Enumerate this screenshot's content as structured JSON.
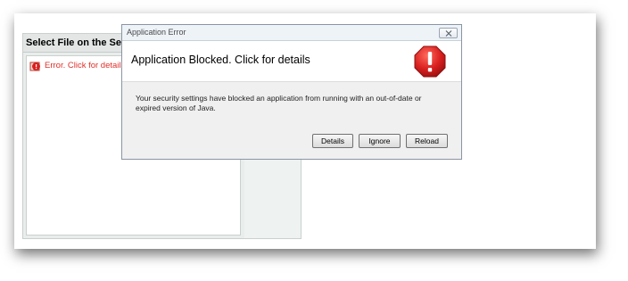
{
  "file_panel": {
    "header": "Select File on the Serv",
    "error_text": "Error. Click for details"
  },
  "dialog": {
    "window_title": "Application Error",
    "title": "Application Blocked. Click for details",
    "message": "Your security settings have blocked an application from running with an out-of-date or expired version of Java.",
    "buttons": {
      "details": "Details",
      "ignore": "Ignore",
      "reload": "Reload"
    },
    "icon": "stop-icon",
    "accent_color": "#d9201f"
  }
}
